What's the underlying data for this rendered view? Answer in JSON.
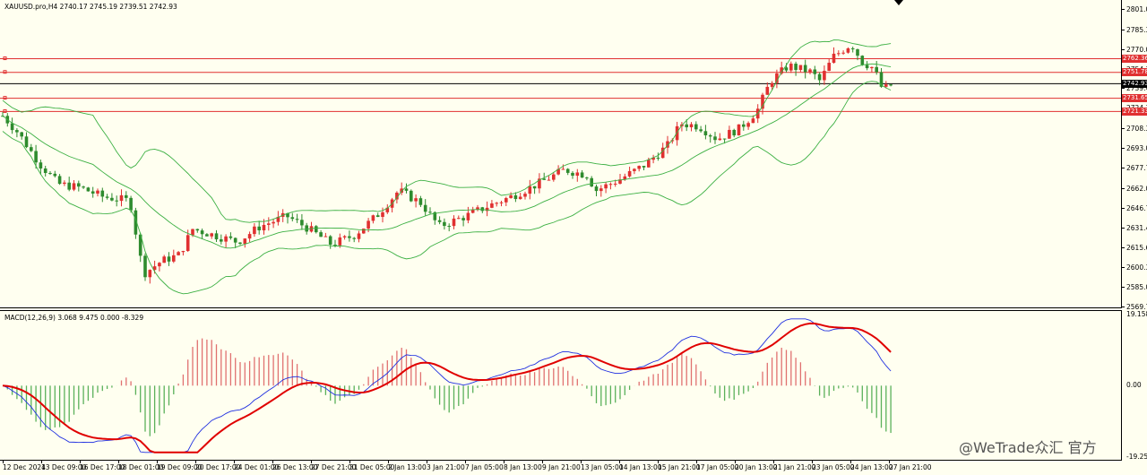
{
  "chart_data": [
    {
      "type": "candlestick",
      "title": "XAUUSD.pro,H4  2740.17 2745.19 2739.51 2742.93",
      "symbol": "XAUUSD.pro",
      "timeframe": "H4",
      "ohlc": {
        "open": 2740.17,
        "high": 2745.19,
        "low": 2739.51,
        "close": 2742.93
      },
      "ylim": [
        2569.75,
        2801.05
      ],
      "ytick_labels": [
        "2801.05",
        "2785.30",
        "2770.00",
        "2754.70",
        "2739.40",
        "2724.10",
        "2708.35",
        "2693.05",
        "2677.75",
        "2662.00",
        "2646.70",
        "2631.40",
        "2615.65",
        "2600.35",
        "2585.05",
        "2569.75"
      ],
      "horizontal_lines": [
        {
          "price": 2762.36,
          "label": "2762.36",
          "color": "#e03030"
        },
        {
          "price": 2751.78,
          "label": "2751.78",
          "color": "#e03030"
        },
        {
          "price": 2731.65,
          "label": "2731.65",
          "color": "#e03030"
        },
        {
          "price": 2721.33,
          "label": "2721.33",
          "color": "#e03030"
        },
        {
          "price": 2742.93,
          "label": "2742.93",
          "color": "#000000"
        }
      ],
      "indicators": [
        "Bollinger Bands"
      ],
      "colors": {
        "up": "#e03030",
        "down": "#2e8b2e",
        "bands": "#3cb043"
      }
    },
    {
      "type": "macd",
      "title": "MACD(12,26,9) 3.068 9.475 0.000 -8.329",
      "ylim": [
        -19.254,
        19.158
      ],
      "ytick_labels": [
        "19.158",
        "0.00",
        "-19.254"
      ],
      "colors": {
        "signal": "#e00000",
        "macd": "#1f2fe0",
        "hist_pos": "#e07070",
        "hist_neg": "#5ab05a"
      }
    }
  ],
  "time_labels": [
    "12 Dec 2024",
    "13 Dec 09:00",
    "16 Dec 17:00",
    "18 Dec 01:00",
    "19 Dec 09:00",
    "20 Dec 17:00",
    "24 Dec 01:00",
    "26 Dec 13:00",
    "27 Dec 21:00",
    "31 Dec 05:00",
    "2 Jan 13:00",
    "3 Jan 21:00",
    "7 Jan 05:00",
    "8 Jan 13:00",
    "9 Jan 21:00",
    "13 Jan 05:00",
    "14 Jan 13:00",
    "15 Jan 21:00",
    "17 Jan 05:00",
    "20 Jan 13:00",
    "21 Jan 21:00",
    "23 Jan 05:00",
    "24 Jan 13:00",
    "27 Jan 21:00"
  ],
  "watermark": "@WeTrade众汇 官方"
}
